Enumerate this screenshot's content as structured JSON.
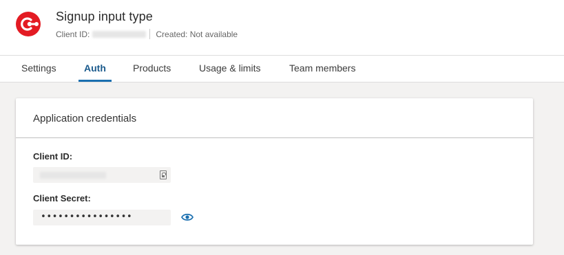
{
  "app": {
    "title": "Signup input type",
    "client_id_label": "Client ID:",
    "created_text": "Created: Not available",
    "brand_color": "#e31b23"
  },
  "tabs": [
    {
      "label": "Settings",
      "active": false
    },
    {
      "label": "Auth",
      "active": true
    },
    {
      "label": "Products",
      "active": false
    },
    {
      "label": "Usage & limits",
      "active": false
    },
    {
      "label": "Team members",
      "active": false
    }
  ],
  "credentials": {
    "title": "Application credentials",
    "client_id_label": "Client ID:",
    "client_secret_label": "Client Secret:",
    "client_secret_value": "••••••••••••••••",
    "copy_icon": "copy-to-clipboard-icon",
    "reveal_icon": "eye-icon"
  },
  "colors": {
    "accent": "#1a6fb0",
    "eye": "#1a6fb0"
  }
}
